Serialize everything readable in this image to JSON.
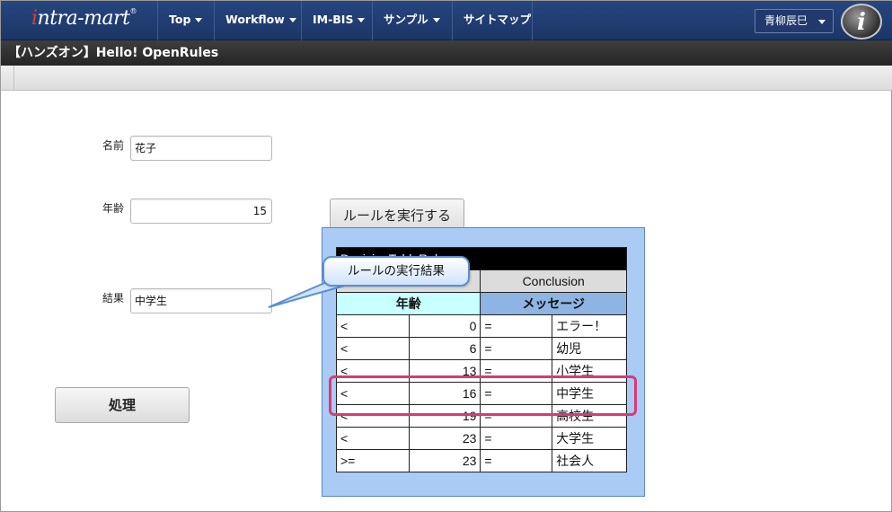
{
  "header": {
    "logo": "intra-mart",
    "nav": [
      {
        "label": "Top"
      },
      {
        "label": "Workflow"
      },
      {
        "label": "IM-BIS"
      },
      {
        "label": "サンプル"
      },
      {
        "label": "サイトマップ"
      }
    ],
    "user": "青柳辰巳",
    "info_icon": "info-icon"
  },
  "title": "【ハンズオン】Hello! OpenRules",
  "form": {
    "name_label": "名前",
    "name_value": "花子",
    "age_label": "年齢",
    "age_value": "15",
    "result_label": "結果",
    "result_value": "中学生",
    "run_button": "ルールを実行する",
    "process_button": "処理"
  },
  "callout": "ルールの実行結果",
  "rule_table": {
    "title": "DecisionTableRule",
    "condition_label": "",
    "conclusion_label": "Conclusion",
    "condition_header": "年齢",
    "conclusion_header": "メッセージ",
    "rows": [
      {
        "op": "<",
        "age": "0",
        "eq": "=",
        "msg": "エラー！"
      },
      {
        "op": "<",
        "age": "6",
        "eq": "=",
        "msg": "幼児"
      },
      {
        "op": "<",
        "age": "13",
        "eq": "=",
        "msg": "小学生"
      },
      {
        "op": "<",
        "age": "16",
        "eq": "=",
        "msg": "中学生"
      },
      {
        "op": "<",
        "age": "19",
        "eq": "=",
        "msg": "高校生"
      },
      {
        "op": "<",
        "age": "23",
        "eq": "=",
        "msg": "大学生"
      },
      {
        "op": ">=",
        "age": "23",
        "eq": "=",
        "msg": "社会人"
      }
    ]
  },
  "colors": {
    "nav_bg": "#1f3b70",
    "title_bg": "#2c2c2c",
    "panel_bg": "#a9cbf4",
    "highlight": "#d93a75",
    "condition_header": "#c8ffff",
    "conclusion_header": "#8db4e2"
  }
}
